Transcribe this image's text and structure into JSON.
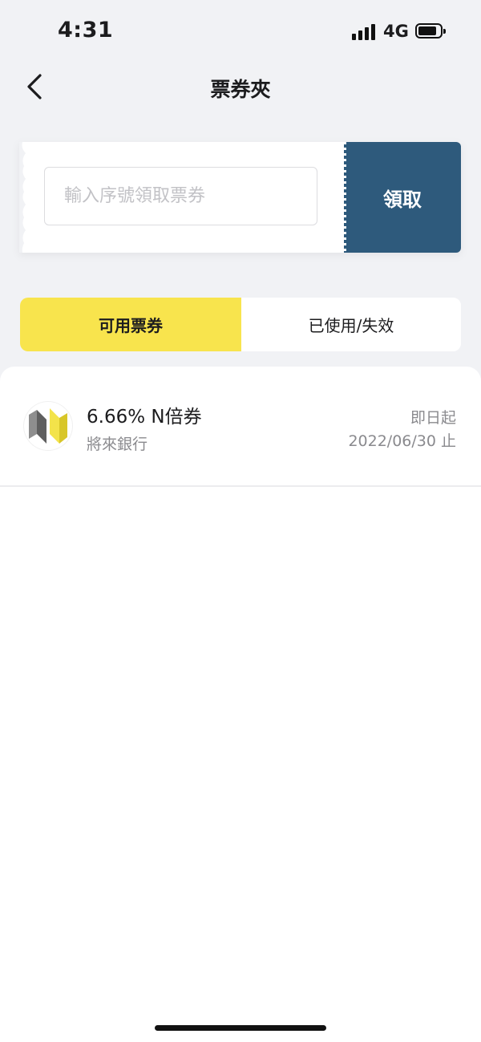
{
  "status_bar": {
    "time": "4:31",
    "network": "4G"
  },
  "header": {
    "title": "票券夾",
    "back_icon": "chevron-left-icon"
  },
  "redeem": {
    "input_placeholder": "輸入序號領取票券",
    "input_value": "",
    "button_label": "領取",
    "button_color": "#2e5a7c"
  },
  "tabs": [
    {
      "label": "可用票券",
      "active": true
    },
    {
      "label": "已使用/失效",
      "active": false
    }
  ],
  "accent_color": "#f8e44d",
  "coupons": [
    {
      "name": "6.66% N倍券",
      "issuer": "將來銀行",
      "valid_from": "即日起",
      "valid_to": "2022/06/30 止",
      "logo_icon": "bank-logo-icon"
    }
  ]
}
